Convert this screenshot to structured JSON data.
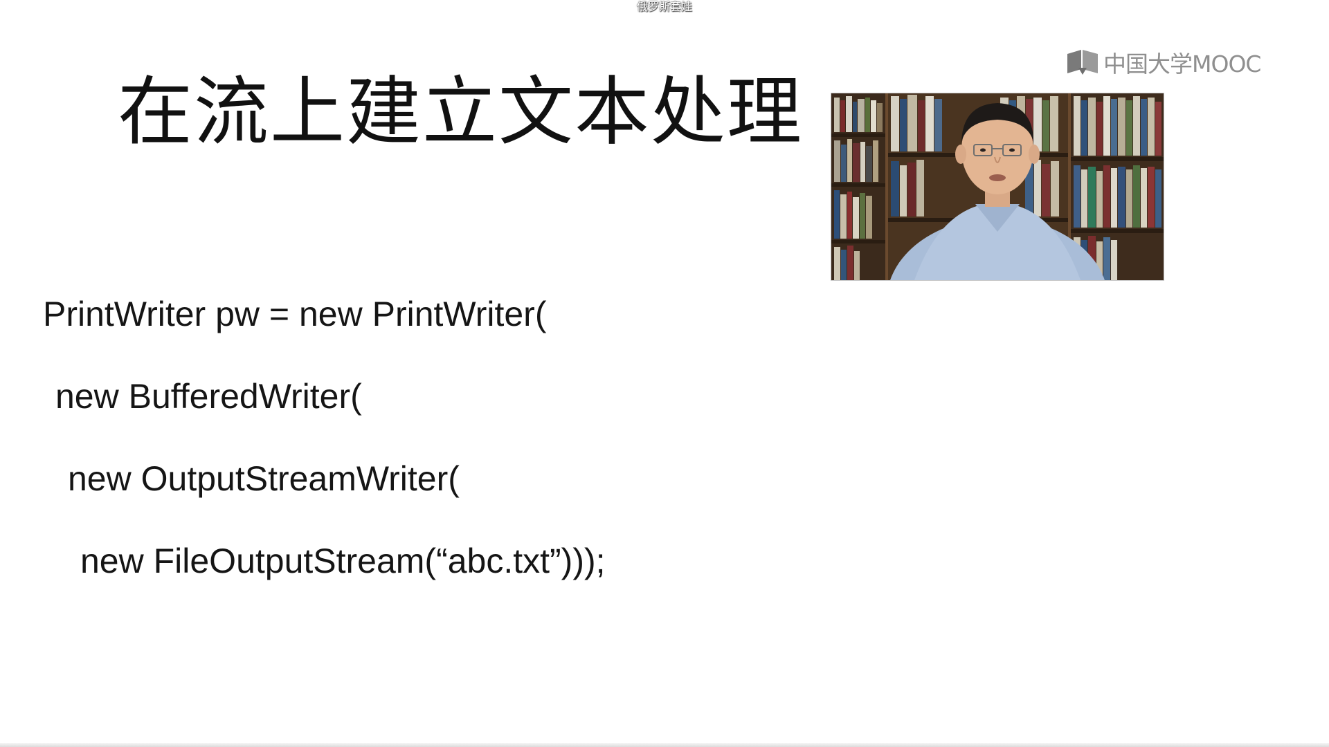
{
  "video_title": "俄罗斯套娃",
  "logo": {
    "icon": "open-book-icon",
    "text": "中国大学MOOC"
  },
  "slide": {
    "title": "在流上建立文本处理",
    "code_lines": [
      "PrintWriter pw = new PrintWriter(",
      "new BufferedWriter(",
      "new OutputStreamWriter(",
      "new FileOutputStream(“abc.txt”)));"
    ]
  },
  "presenter_video": {
    "subject": "presenter-in-front-of-bookshelf"
  },
  "colors": {
    "background": "#ffffff",
    "text": "#151515",
    "logo": "#8f8f8f"
  }
}
